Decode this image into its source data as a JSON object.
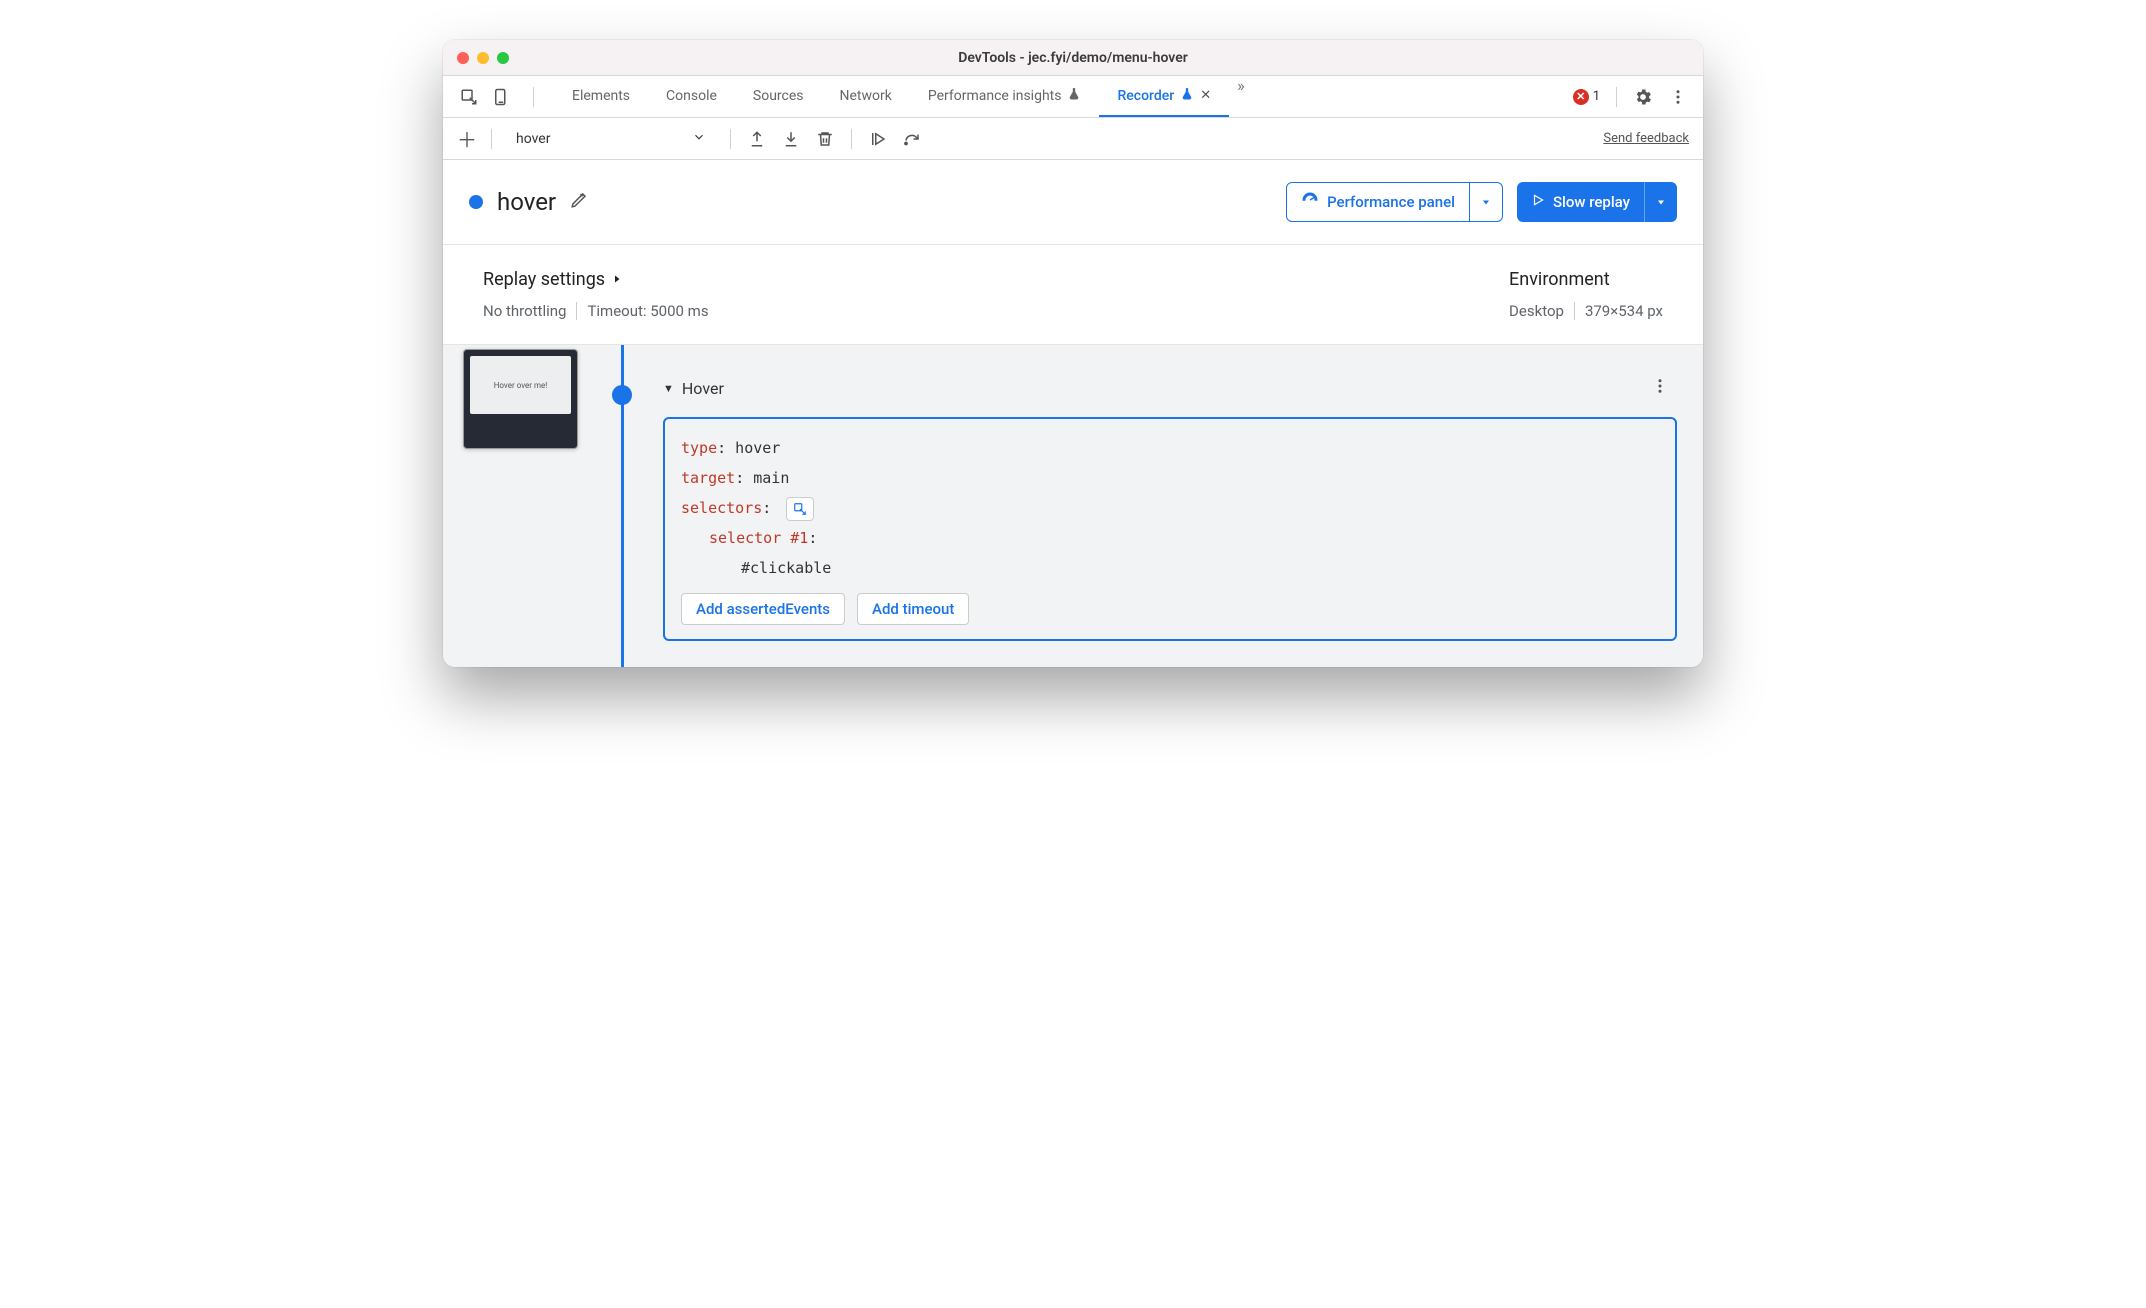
{
  "window_title": "DevTools - jec.fyi/demo/menu-hover",
  "tabs": {
    "elements": "Elements",
    "console": "Console",
    "sources": "Sources",
    "network": "Network",
    "performance_insights": "Performance insights",
    "recorder": "Recorder"
  },
  "error_count": "1",
  "subtoolbar": {
    "recording_name": "hover",
    "feedback": "Send feedback"
  },
  "header": {
    "title": "hover",
    "perf_panel": "Performance panel",
    "slow_replay": "Slow replay"
  },
  "settings": {
    "replay_title": "Replay settings",
    "no_throttling": "No throttling",
    "timeout": "Timeout: 5000 ms",
    "env_title": "Environment",
    "device": "Desktop",
    "dimensions": "379×534 px"
  },
  "thumbnail_text": "Hover over me!",
  "step": {
    "name": "Hover",
    "type_key": "type",
    "type_val": ": hover",
    "target_key": "target",
    "target_val": ": main",
    "selectors_key": "selectors",
    "selectors_colon": ":",
    "selector1_key": "selector #1",
    "selector1_colon": ":",
    "selector1_val": "#clickable",
    "add_asserted": "Add assertedEvents",
    "add_timeout": "Add timeout"
  }
}
